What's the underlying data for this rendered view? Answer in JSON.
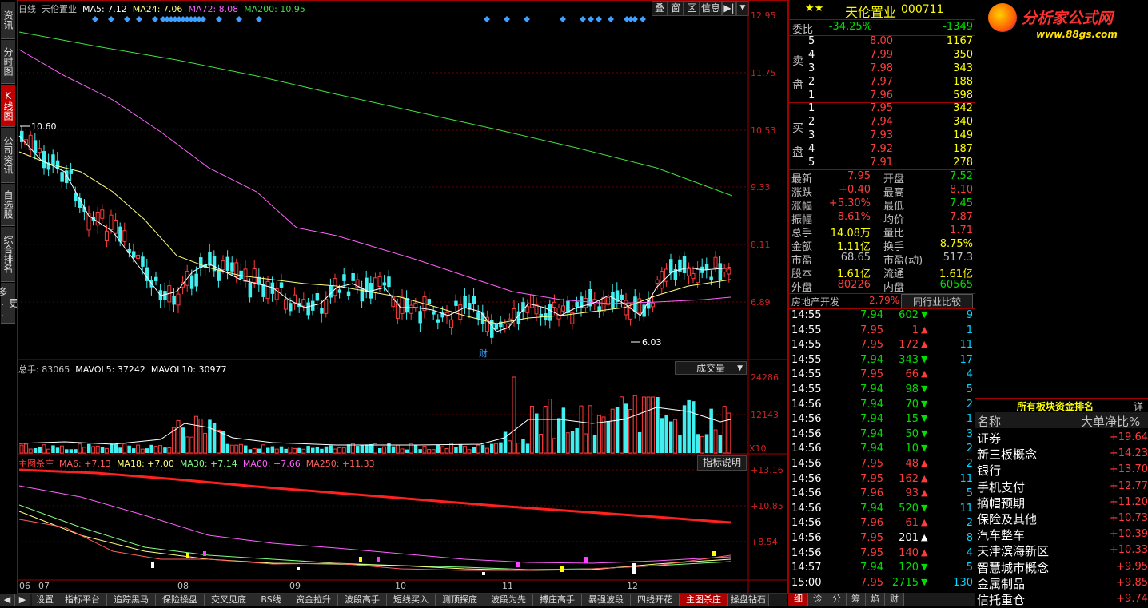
{
  "left_tabs": [
    "资讯",
    "分时图",
    "K线图",
    "公司资讯",
    "自选股",
    "综合排名",
    "更多.."
  ],
  "active_left_tab": 2,
  "main_chart": {
    "legend": [
      {
        "text": "日线",
        "color": "#c0c0c0"
      },
      {
        "text": "天伦置业",
        "color": "#c0c0c0"
      },
      {
        "text": "MA5: 7.12",
        "color": "#ffffff"
      },
      {
        "text": "MA24: 7.06",
        "color": "#ffff80"
      },
      {
        "text": "MA72: 8.08",
        "color": "#ff60ff"
      },
      {
        "text": "MA200: 10.95",
        "color": "#40e040"
      }
    ],
    "toolbar": [
      "叠",
      "窗",
      "区",
      "信息",
      "▶|",
      "▼"
    ],
    "y_ticks": [
      "12.95",
      "11.75",
      "10.53",
      "9.33",
      "8.11",
      "6.89"
    ],
    "high_label": "10.60",
    "low_label": "6.03",
    "event_label": "财"
  },
  "volume_chart": {
    "legend": [
      {
        "text": "总手: 83065",
        "color": "#c0c0c0"
      },
      {
        "text": "MAVOL5: 37242",
        "color": "#ffffff"
      },
      {
        "text": "MAVOL10: 30977",
        "color": "#ffffff"
      }
    ],
    "selector": "成交量",
    "y_ticks": [
      "24286",
      "12143"
    ],
    "unit": "X10"
  },
  "indicator_chart": {
    "legend": [
      {
        "text": "主图杀庄",
        "color": "#ff3c3c"
      },
      {
        "text": "MA6: +7.13",
        "color": "#ff6060"
      },
      {
        "text": "MA18: +7.00",
        "color": "#ffff80"
      },
      {
        "text": "MA30: +7.14",
        "color": "#80ff80"
      },
      {
        "text": "MA60: +7.66",
        "color": "#ff60ff"
      },
      {
        "text": "MA250: +11.33",
        "color": "#ff6060"
      }
    ],
    "button": "指标说明",
    "y_ticks": [
      "+13.16",
      "+10.85",
      "+8.54"
    ]
  },
  "x_axis": [
    "06",
    "07",
    "08",
    "09",
    "10",
    "11",
    "12"
  ],
  "bottom_tabs": [
    "设置",
    "指标平台",
    "追踪黑马",
    "保险操盘",
    "交叉见底",
    "BS线",
    "资金拉升",
    "波段高手",
    "短线买入",
    "测顶探底",
    "波段为先",
    "搏庄高手",
    "暴强波段",
    "四线开花",
    "主图杀庄",
    "操盘钻石"
  ],
  "active_bottom_tab": 14,
  "quote": {
    "stars": "★★",
    "name": "天伦置业",
    "code": "000711",
    "weibi_label": "委比",
    "weibi_pct": "-34.25%",
    "weibi_val": "-1349",
    "sell_label": [
      "卖",
      "盘"
    ],
    "buy_label": [
      "买",
      "盘"
    ],
    "sell": [
      {
        "lvl": "5",
        "price": "8.00",
        "vol": "1167"
      },
      {
        "lvl": "4",
        "price": "7.99",
        "vol": "350"
      },
      {
        "lvl": "3",
        "price": "7.98",
        "vol": "343"
      },
      {
        "lvl": "2",
        "price": "7.97",
        "vol": "188"
      },
      {
        "lvl": "1",
        "price": "7.96",
        "vol": "598"
      }
    ],
    "buy": [
      {
        "lvl": "1",
        "price": "7.95",
        "vol": "342"
      },
      {
        "lvl": "2",
        "price": "7.94",
        "vol": "340"
      },
      {
        "lvl": "3",
        "price": "7.93",
        "vol": "149"
      },
      {
        "lvl": "4",
        "price": "7.92",
        "vol": "187"
      },
      {
        "lvl": "5",
        "price": "7.91",
        "vol": "278"
      }
    ],
    "stats": [
      {
        "l1": "最新",
        "v1": "7.95",
        "c1": "red",
        "l2": "开盘",
        "v2": "7.52",
        "c2": "green"
      },
      {
        "l1": "涨跌",
        "v1": "+0.40",
        "c1": "red",
        "l2": "最高",
        "v2": "8.10",
        "c2": "red"
      },
      {
        "l1": "涨幅",
        "v1": "+5.30%",
        "c1": "red",
        "l2": "最低",
        "v2": "7.45",
        "c2": "green"
      },
      {
        "l1": "振幅",
        "v1": "8.61%",
        "c1": "red",
        "l2": "均价",
        "v2": "7.87",
        "c2": "red"
      },
      {
        "l1": "总手",
        "v1": "14.08万",
        "c1": "yellow",
        "l2": "量比",
        "v2": "1.71",
        "c2": "red"
      },
      {
        "l1": "金额",
        "v1": "1.11亿",
        "c1": "yellow",
        "l2": "换手",
        "v2": "8.75%",
        "c2": "yellow"
      },
      {
        "l1": "市盈",
        "v1": "68.65",
        "c1": "gray",
        "l2": "市盈(动)",
        "v2": "517.3",
        "c2": "gray"
      },
      {
        "l1": "股本",
        "v1": "1.61亿",
        "c1": "yellow",
        "l2": "流通",
        "v2": "1.61亿",
        "c2": "yellow"
      },
      {
        "l1": "外盘",
        "v1": "80226",
        "c1": "red",
        "l2": "内盘",
        "v2": "60565",
        "c2": "green"
      }
    ],
    "sector": "房地产开发",
    "sector_pct": "2.79%",
    "compare_btn": "同行业比较",
    "ticks": [
      {
        "t": "14:55",
        "p": "7.94",
        "pc": "green",
        "v": "602",
        "d": "down",
        "n": "9"
      },
      {
        "t": "14:55",
        "p": "7.95",
        "pc": "red",
        "v": "1",
        "d": "up",
        "n": "1"
      },
      {
        "t": "14:55",
        "p": "7.95",
        "pc": "red",
        "v": "172",
        "d": "up",
        "n": "11"
      },
      {
        "t": "14:55",
        "p": "7.94",
        "pc": "green",
        "v": "343",
        "d": "down",
        "n": "17"
      },
      {
        "t": "14:55",
        "p": "7.95",
        "pc": "red",
        "v": "66",
        "d": "up",
        "n": "4"
      },
      {
        "t": "14:55",
        "p": "7.94",
        "pc": "green",
        "v": "98",
        "d": "down",
        "n": "5"
      },
      {
        "t": "14:56",
        "p": "7.94",
        "pc": "green",
        "v": "70",
        "d": "down",
        "n": "2"
      },
      {
        "t": "14:56",
        "p": "7.94",
        "pc": "green",
        "v": "15",
        "d": "down",
        "n": "1"
      },
      {
        "t": "14:56",
        "p": "7.94",
        "pc": "green",
        "v": "50",
        "d": "down",
        "n": "3"
      },
      {
        "t": "14:56",
        "p": "7.94",
        "pc": "green",
        "v": "10",
        "d": "down",
        "n": "2"
      },
      {
        "t": "14:56",
        "p": "7.95",
        "pc": "red",
        "v": "48",
        "d": "up",
        "n": "2"
      },
      {
        "t": "14:56",
        "p": "7.95",
        "pc": "red",
        "v": "162",
        "d": "up",
        "n": "11"
      },
      {
        "t": "14:56",
        "p": "7.96",
        "pc": "red",
        "v": "93",
        "d": "up",
        "n": "5"
      },
      {
        "t": "14:56",
        "p": "7.94",
        "pc": "green",
        "v": "520",
        "d": "down",
        "n": "11"
      },
      {
        "t": "14:56",
        "p": "7.96",
        "pc": "red",
        "v": "61",
        "d": "up",
        "n": "2"
      },
      {
        "t": "14:56",
        "p": "7.95",
        "pc": "red",
        "v": "201",
        "d": "white",
        "n": "8"
      },
      {
        "t": "14:56",
        "p": "7.95",
        "pc": "red",
        "v": "140",
        "d": "up",
        "n": "4"
      },
      {
        "t": "14:57",
        "p": "7.94",
        "pc": "green",
        "v": "120",
        "d": "down",
        "n": "5"
      },
      {
        "t": "15:00",
        "p": "7.95",
        "pc": "red",
        "v": "2715",
        "d": "down",
        "n": "130"
      }
    ],
    "bottom_tabs": [
      "细",
      "诊",
      "分",
      "筹",
      "焰",
      "财"
    ]
  },
  "rank": {
    "logo": "分析家公式网",
    "logo_url": "www.88gs.com",
    "title": "所有板块资金排名",
    "detail": "详",
    "col_name": "名称",
    "col_value": "大单净比%",
    "rows": [
      {
        "name": "证券",
        "val": "+19.64"
      },
      {
        "name": "新三板概念",
        "val": "+14.23"
      },
      {
        "name": "银行",
        "val": "+13.70"
      },
      {
        "name": "手机支付",
        "val": "+12.77"
      },
      {
        "name": "摘帽预期",
        "val": "+11.20"
      },
      {
        "name": "保险及其他",
        "val": "+10.73"
      },
      {
        "name": "汽车整车",
        "val": "+10.39"
      },
      {
        "name": "天津滨海新区",
        "val": "+10.33"
      },
      {
        "name": "智慧城市概念",
        "val": "+9.95"
      },
      {
        "name": "金属制品",
        "val": "+9.85"
      },
      {
        "name": "信托重仓",
        "val": "+9.74"
      }
    ]
  }
}
